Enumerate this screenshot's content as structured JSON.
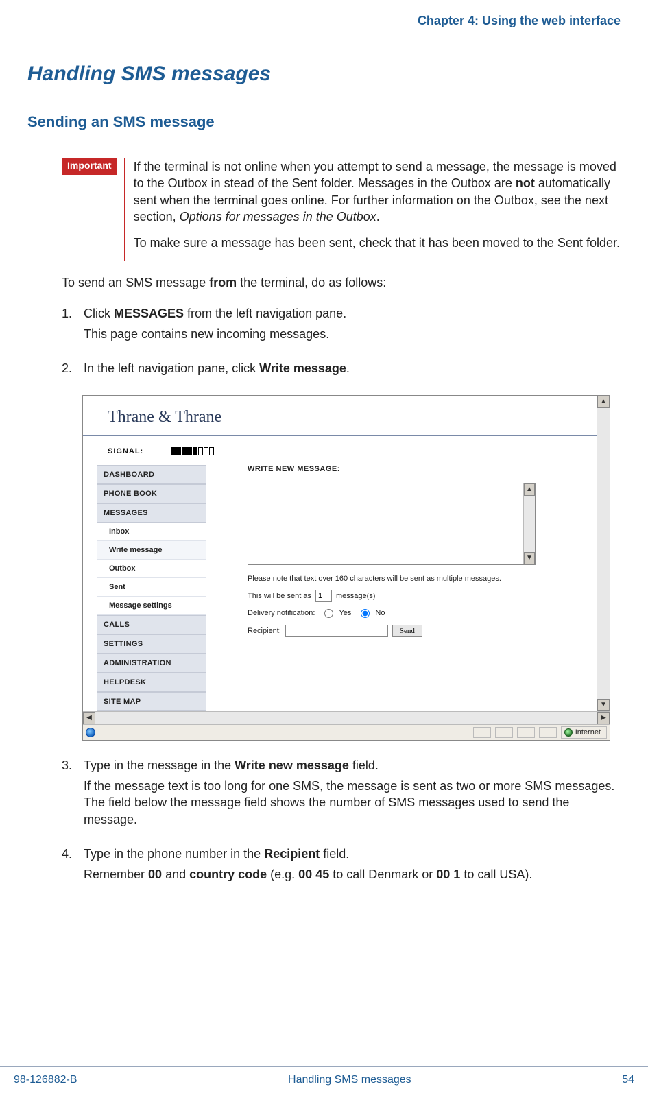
{
  "chapter_header": "Chapter 4: Using the web interface",
  "title": "Handling SMS messages",
  "subtitle": "Sending an SMS message",
  "important": {
    "tag": "Important",
    "p1a": "If the terminal is not online when you attempt to send a message, the message is moved to the Outbox in stead of the Sent folder. Messages in the Outbox are ",
    "p1b_bold": "not",
    "p1c": " automatically sent when the terminal goes online. For further information on the Outbox, see the next section, ",
    "p1d_italic": "Options for messages in the Outbox",
    "p1e": ".",
    "p2": "To make sure a message has been sent, check that it has been moved to the Sent folder."
  },
  "intro_a": "To send an SMS message ",
  "intro_b_bold": "from",
  "intro_c": " the terminal, do as follows:",
  "steps": {
    "s1_num": "1.",
    "s1a": "Click ",
    "s1b_bold": "MESSAGES",
    "s1c": " from the left navigation pane.",
    "s1_line2": "This page contains new incoming messages.",
    "s2_num": "2.",
    "s2a": "In the left navigation pane, click ",
    "s2b_bold": "Write message",
    "s2c": ".",
    "s3_num": "3.",
    "s3a": "Type in the message in the ",
    "s3b_bold": "Write new message",
    "s3c": " field.",
    "s3_p2": "If the message text is too long for one SMS, the message is sent as two or more SMS messages. The field below the message field shows the number of SMS messages used to send the message.",
    "s4_num": "4.",
    "s4a": "Type in the phone number in the ",
    "s4b_bold": "Recipient",
    "s4c": " field.",
    "s4d": "Remember ",
    "s4e_bold": "00",
    "s4f": " and ",
    "s4g_bold": "country code",
    "s4h": " (e.g. ",
    "s4i_bold": "00 45",
    "s4j": " to call Denmark or ",
    "s4k_bold": "00 1",
    "s4l": " to call USA)."
  },
  "screenshot": {
    "brand": "Thrane & Thrane",
    "signal_label": "SIGNAL:",
    "signal_filled": 5,
    "signal_total": 8,
    "nav": {
      "dashboard": "DASHBOARD",
      "phone_book": "PHONE BOOK",
      "messages": "MESSAGES",
      "inbox": "Inbox",
      "write_message": "Write message",
      "outbox": "Outbox",
      "sent": "Sent",
      "msg_settings": "Message settings",
      "calls": "CALLS",
      "settings": "SETTINGS",
      "administration": "ADMINISTRATION",
      "helpdesk": "HELPDESK",
      "site_map": "SITE MAP"
    },
    "content": {
      "title": "WRITE NEW MESSAGE:",
      "note": "Please note that text over 160 characters will be sent as multiple messages.",
      "sent_as_a": "This will be sent as",
      "sent_as_val": "1",
      "sent_as_b": "message(s)",
      "delivery_label": "Delivery notification:",
      "yes": "Yes",
      "no": "No",
      "delivery_selected": "no",
      "recipient_label": "Recipient:",
      "recipient_value": "",
      "send_btn": "Send"
    },
    "status_zone": "Internet"
  },
  "footer": {
    "left": "98-126882-B",
    "center": "Handling SMS messages",
    "right": "54"
  }
}
